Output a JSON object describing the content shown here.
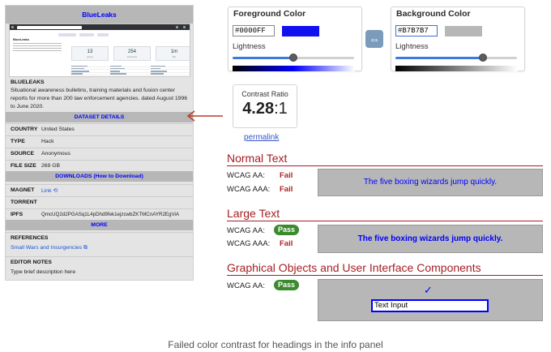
{
  "panel": {
    "title": "BlueLeaks",
    "thumb": {
      "heading": "BlueLeaks",
      "stats": [
        {
          "number": "13",
          "label": "groups"
        },
        {
          "number": "254",
          "label": "documents"
        },
        {
          "number": "1m",
          "label": "files"
        }
      ]
    },
    "name": "BLUELEAKS",
    "description": "Situational awareness bulletins, training materials and fusion center reports for more than 200 law enforcement agencies. dated August 1996 to June 2020.",
    "dataset_details_label": "DATASET DETAILS",
    "details": [
      {
        "label": "COUNTRY",
        "value": "United States"
      },
      {
        "label": "TYPE",
        "value": "Hack"
      },
      {
        "label": "SOURCE",
        "value": "Anonymous"
      },
      {
        "label": "FILE SIZE",
        "value": "269 GB"
      }
    ],
    "downloads_label": "DOWNLOADS",
    "how_to_download": "(How to Download)",
    "magnet_label": "MAGNET",
    "magnet_value": "Link",
    "torrent_label": "TORRENT",
    "ipfs_label": "IPFS",
    "ipfs_value": "QmcUQ2d2PGASq1L4pDhd9fek1ejzcwbZKTMCnAYR2EgViA",
    "more_label": "MORE",
    "references_label": "REFERENCES",
    "reference_link": "Small Wars and Insurgencies",
    "editor_notes_label": "EDITOR NOTES",
    "editor_notes_value": "Type brief description here"
  },
  "foreground": {
    "title": "Foreground Color",
    "hex": "#0000FF",
    "swatch_color": "#1010f0",
    "lightness_label": "Lightness",
    "lightness": 0.5
  },
  "background": {
    "title": "Background Color",
    "hex": "#B7B7B7",
    "swatch_color": "#b7b7b7",
    "lightness_label": "Lightness",
    "lightness": 0.72
  },
  "swap_icon": "⇔",
  "contrast": {
    "label": "Contrast Ratio",
    "value_main": "4.28",
    "value_suffix": ":1"
  },
  "permalink": "permalink",
  "normal_text": {
    "heading": "Normal Text",
    "aa_label": "WCAG AA:",
    "aa_result": "Fail",
    "aaa_label": "WCAG AAA:",
    "aaa_result": "Fail",
    "sample": "The five boxing wizards jump quickly."
  },
  "large_text": {
    "heading": "Large Text",
    "aa_label": "WCAG AA:",
    "aa_result": "Pass",
    "aaa_label": "WCAG AAA:",
    "aaa_result": "Fail",
    "sample": "The five boxing wizards jump quickly."
  },
  "graphical": {
    "heading": "Graphical Objects and User Interface Components",
    "aa_label": "WCAG AA:",
    "aa_result": "Pass",
    "check_icon": "✓",
    "input_value": "Text Input"
  },
  "caption": "Failed color contrast for headings in the info panel",
  "colors": {
    "accent_red": "#a41e22",
    "pass_green": "#3c8a2e",
    "fail_red": "#b22222",
    "foreground_blue": "#0000ff",
    "background_gray": "#b7b7b7"
  }
}
